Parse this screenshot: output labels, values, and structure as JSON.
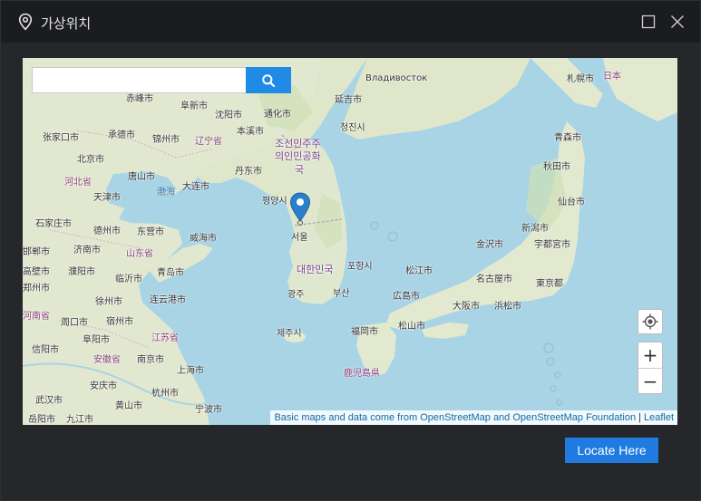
{
  "window": {
    "title": "가상위치",
    "title_icon": "location-pin-icon",
    "maximize_icon": "maximize-icon",
    "close_icon": "close-icon"
  },
  "map": {
    "search": {
      "value": "",
      "placeholder": "",
      "button_icon": "search-icon"
    },
    "marker_icon": "map-marker-icon",
    "controls": {
      "locate_icon": "crosshair-icon",
      "zoom_in": "+",
      "zoom_out": "−"
    },
    "attribution": {
      "text": "Basic maps and data come from OpenStreetMap and OpenStreetMap Foundation",
      "leaflet": "Leaflet"
    },
    "labels": {
      "l0": "Владивосток",
      "l1": "札幌市",
      "l2": "日本",
      "l3": "赤峰市",
      "l4": "阜新市",
      "l5": "沈阳市",
      "l6": "通化市",
      "l7": "延吉市",
      "l8": "张家口市",
      "l9": "承德市",
      "l10": "锦州市",
      "l11": "辽宁省",
      "l12": "本溪市",
      "l13": "조선민주주",
      "l14": "의인민공화",
      "l15": "국",
      "l16": "청진시",
      "l17": "青森市",
      "l18": "北京市",
      "l19": "唐山市",
      "l20": "河北省",
      "l21": "丹东市",
      "l22": "大连市",
      "l23": "渤海",
      "l24": "天津市",
      "l25": "秋田市",
      "l26": "평양시",
      "l27": "石家庄市",
      "l28": "德州市",
      "l29": "东营市",
      "l30": "威海市",
      "l31": "서울",
      "l32": "仙台市",
      "l33": "新潟市",
      "l34": "金沢市",
      "l35": "宇都宮市",
      "l36": "济南市",
      "l37": "山东省",
      "l38": "濮阳市",
      "l39": "临沂市",
      "l40": "青岛市",
      "l41": "대한민국",
      "l42": "포항시",
      "l43": "松江市",
      "l44": "名古屋市",
      "l45": "東京都",
      "l46": "徐州市",
      "l47": "连云港市",
      "l48": "광주",
      "l49": "부산",
      "l50": "広島市",
      "l51": "大阪市",
      "l52": "浜松市",
      "l53": "周口市",
      "l54": "宿州市",
      "l55": "阜阳市",
      "l56": "江苏省",
      "l57": "제주시",
      "l58": "福岡市",
      "l59": "松山市",
      "l60": "信阳市",
      "l61": "安徽省",
      "l62": "南京市",
      "l63": "上海市",
      "l64": "鹿児島県",
      "l65": "安庆市",
      "l66": "杭州市",
      "l67": "武汉市",
      "l68": "黄山市",
      "l69": "宁波市",
      "l70": "岳阳市",
      "l71": "九江市",
      "l72": "邯郸市",
      "l73": "郑州市",
      "l74": "河南省",
      "l75": "高壁市"
    }
  },
  "footer": {
    "locate_button": "Locate Here"
  },
  "colors": {
    "accent": "#1f7be0",
    "search_button": "#1f8be6",
    "sea": "#a8d4e6",
    "land": "#dfe8d0",
    "marker": "#2a81cb"
  }
}
